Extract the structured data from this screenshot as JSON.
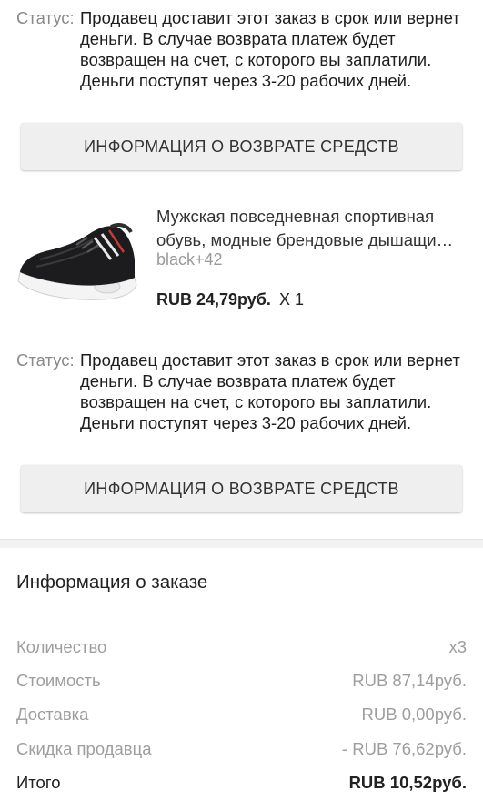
{
  "orders": [
    {
      "status_label": "Статус:",
      "status_text": "Продавец доставит этот заказ в срок или вернет деньги. В случае возврата платеж будет возвращен на счет, с которого вы заплатили. Деньги поступят через 3-20 рабочих дней.",
      "refund_button": "ИНФОРМАЦИЯ О ВОЗВРАТЕ СРЕДСТВ"
    },
    {
      "status_label": "Статус:",
      "status_text": "Продавец доставит этот заказ в срок или вернет деньги. В случае возврата платеж будет возвращен на счет, с которого вы заплатили. Деньги поступят через 3-20 рабочих дней.",
      "refund_button": "ИНФОРМАЦИЯ О ВОЗВРАТЕ СРЕДСТВ"
    }
  ],
  "product": {
    "title": "Мужская повседневная спортивная обувь, модные брендовые дышащи…",
    "variant": "black+42",
    "price": "RUB 24,79руб.",
    "quantity": "X 1",
    "image_icon": "sneaker-image"
  },
  "order_info": {
    "title": "Информация о заказе",
    "rows": [
      {
        "label": "Количество",
        "value": "x3"
      },
      {
        "label": "Стоимость",
        "value": "RUB 87,14руб."
      },
      {
        "label": "Доставка",
        "value": "RUB 0,00руб."
      },
      {
        "label": "Скидка продавца",
        "value": "- RUB 76,62руб."
      },
      {
        "label": "Итого",
        "value": "RUB 10,52руб."
      }
    ]
  }
}
